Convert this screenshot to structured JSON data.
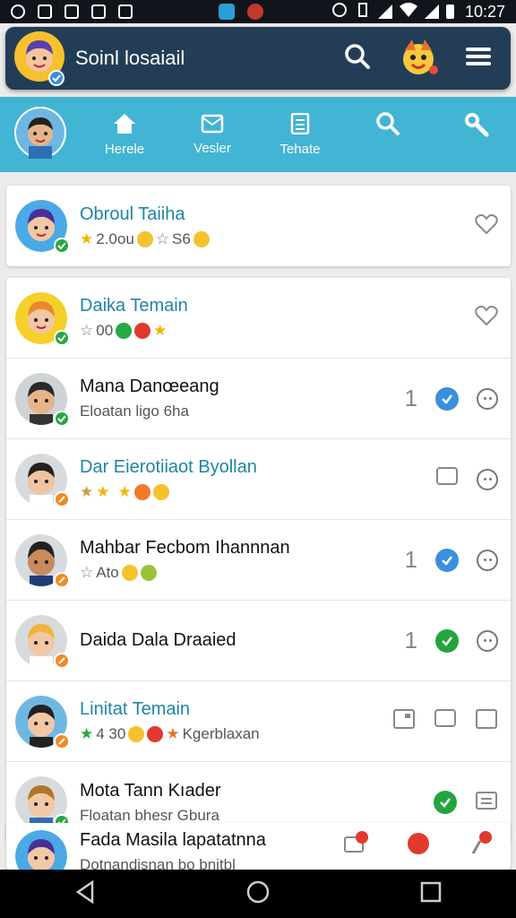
{
  "status_bar": {
    "time": "10:27"
  },
  "header": {
    "title": "Soinl losaiail",
    "icons": [
      "search-icon",
      "mascot-icon",
      "menu-icon"
    ]
  },
  "nav": {
    "tabs": [
      {
        "label": "Herele",
        "icon": "home-icon"
      },
      {
        "label": "Vesler",
        "icon": "message-icon"
      },
      {
        "label": "Tehate",
        "icon": "document-icon"
      },
      {
        "label": "",
        "icon": "search-icon"
      },
      {
        "label": "",
        "icon": "zoom-icon"
      }
    ]
  },
  "contacts": [
    {
      "name": "Obroul Taiiha",
      "sub": "2.0ou",
      "sub2": "S6",
      "style": "teal",
      "badge": "green"
    },
    {
      "name": "Daika Temain",
      "sub": "00",
      "style": "teal",
      "badge": "green"
    },
    {
      "name": "Mana Danœeang",
      "sub": "Eloatan ligo 6ha",
      "count": "1",
      "style": "plain",
      "badge": "green"
    },
    {
      "name": "Dar Eierotiiaot Byollan",
      "sub": "",
      "style": "teal",
      "badge": "orange"
    },
    {
      "name": "Mahbar Fecbom Ihannnan",
      "sub": "Ato",
      "count": "1",
      "style": "plain",
      "badge": "orange"
    },
    {
      "name": "Daida Dala Draaied",
      "sub": "",
      "count": "1",
      "style": "plain",
      "badge": "orange"
    },
    {
      "name": "Linitat Temain",
      "sub": "4 30",
      "sub2": "Kgerblaxan",
      "style": "teal",
      "badge": "orange"
    },
    {
      "name": "Mota Tann Kıader",
      "sub": "Floatan bhesr Gbura",
      "style": "plain",
      "badge": "green"
    },
    {
      "name": "Fada Masila lapatatnna",
      "sub": "Dotnandisnan bo bnitbl",
      "style": "plain",
      "badge": "green"
    }
  ],
  "colors": {
    "header": "#243d57",
    "nav": "#42b4d4",
    "teal_text": "#1f84a5",
    "check_blue": "#3a8fde",
    "check_green": "#23a53e"
  }
}
